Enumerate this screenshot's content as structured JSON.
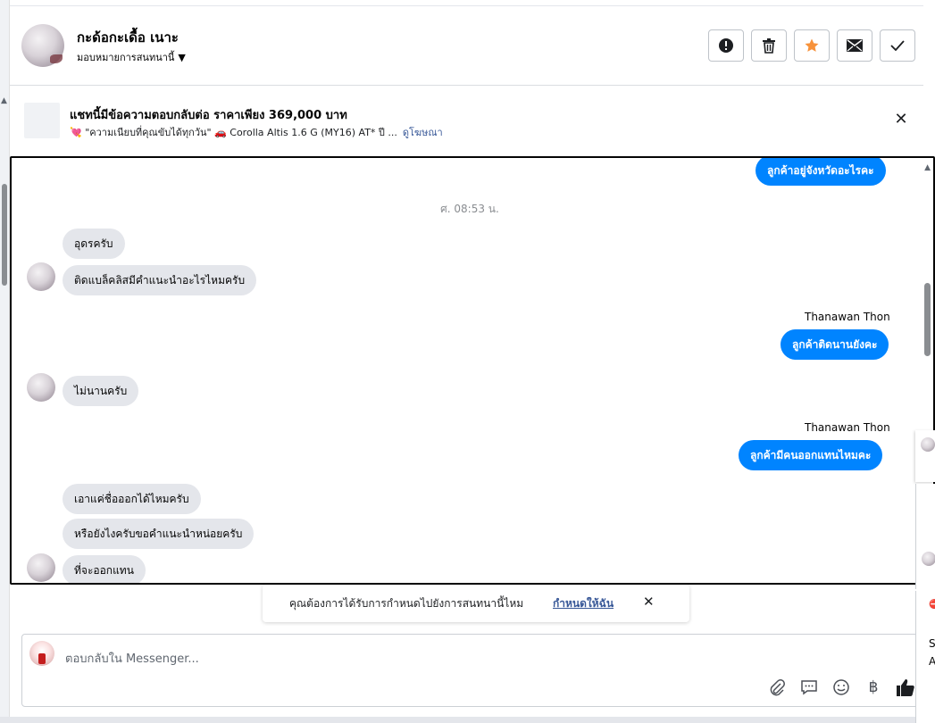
{
  "header": {
    "name": "กะด้อกะเดื้อ เนาะ",
    "assign_label": "มอบหมายการสนทนานี้",
    "actions": [
      "mark-spam",
      "delete",
      "star",
      "mark-unread",
      "done"
    ]
  },
  "ad": {
    "title": "แชทนี้มีข้อความตอบกลับต่อ ราคาเพียง 369,000 บาท",
    "subtitle": "💘 \"ความเนียบที่คุณขับได้ทุกวัน\" 🚗 Corolla Altis 1.6 G (MY16) AT* ปี ...",
    "link": "ดูโฆษณา",
    "close": "✕"
  },
  "messages": {
    "first_out": "ลูกค้าอยู่จังหวัดอะไรคะ",
    "timestamp": "ศ. 08:53 น.",
    "in1": "อุดรครับ",
    "in2": "ติดแบล็คลิสมีคำแนะนำอะไรไหมครับ",
    "sender1": "Thanawan Thon",
    "out2": "ลูกค้าติดนานยังคะ",
    "in3": "ไม่นานครับ",
    "sender2": "Thanawan Thon",
    "out3": "ลูกค้ามีคนออกแทนไหมคะ",
    "in4": "เอาแค่ชื่อออกได้ไหมครับ",
    "in5": "หรือยังไงครับขอคำแนะนำหน่อยครับ",
    "in6": "ที่จะออกแทน"
  },
  "toast": {
    "text": "คุณต้องการได้รับการกำหนดไปยังการสนทนานี้ไหม",
    "link": "กำหนดให้ฉัน",
    "close": "✕"
  },
  "composer": {
    "placeholder": "ตอบกลับใน Messenger...",
    "tools": [
      "attach-icon",
      "saved-reply-icon",
      "emoji-icon",
      "baht-icon",
      "like-icon"
    ],
    "baht_symbol": "฿"
  },
  "side": {
    "card3_line1": "S",
    "card3_line2": "A"
  },
  "colors": {
    "accent": "#0084ff",
    "star": "#f7923b",
    "link": "#385898"
  }
}
